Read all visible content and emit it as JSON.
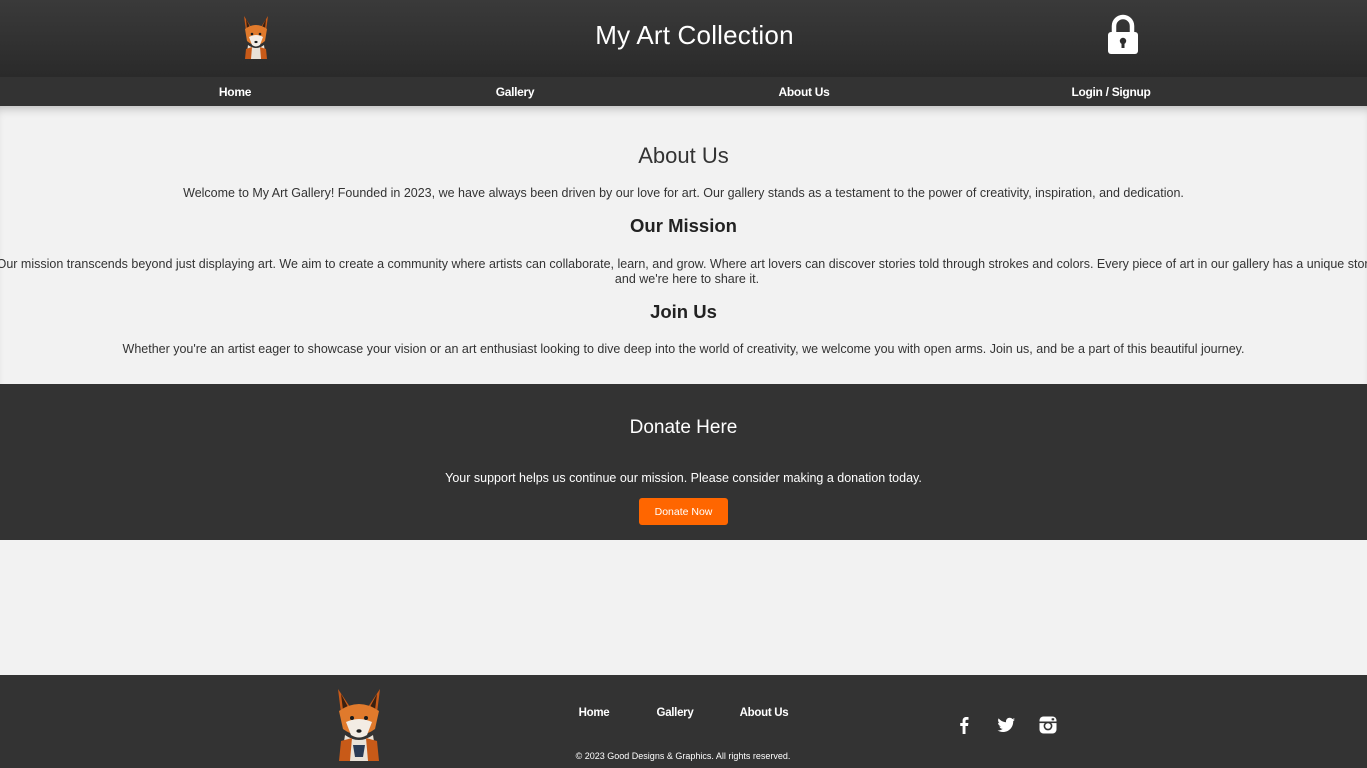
{
  "header": {
    "title": "My Art Collection",
    "logo_icon": "fox-logo-icon",
    "login_icon": "lock-icon"
  },
  "nav": {
    "items": [
      {
        "label": "Home"
      },
      {
        "label": "Gallery"
      },
      {
        "label": "About Us"
      },
      {
        "label": "Login / Signup"
      }
    ]
  },
  "about": {
    "heading": "About Us",
    "welcome": "Welcome to My Art Gallery! Founded in 2023, we have always been driven by our love for art. Our gallery stands as a testament to the power of creativity, inspiration, and dedication.",
    "mission_heading": "Our Mission",
    "mission_text": "Our mission transcends beyond just displaying art. We aim to create a community where artists can collaborate, learn, and grow. Where art lovers can discover stories told through strokes and colors. Every piece of art in our gallery has a unique story, and we're here to share it.",
    "join_heading": "Join Us",
    "join_text": "Whether you're an artist eager to showcase your vision or an art enthusiast looking to dive deep into the world of creativity, we welcome you with open arms. Join us, and be a part of this beautiful journey."
  },
  "donate": {
    "heading": "Donate Here",
    "text": "Your support helps us continue our mission. Please consider making a donation today.",
    "button_label": "Donate Now",
    "button_color": "#ff6600"
  },
  "footer": {
    "links": [
      {
        "label": "Home"
      },
      {
        "label": "Gallery"
      },
      {
        "label": "About Us"
      }
    ],
    "copyright": "© 2023 Good Designs & Graphics. All rights reserved.",
    "social": [
      "facebook-icon",
      "twitter-icon",
      "instagram-icon"
    ]
  },
  "colors": {
    "dark_bg": "#333333",
    "page_bg": "#f2f2f2",
    "accent": "#ff6600"
  }
}
